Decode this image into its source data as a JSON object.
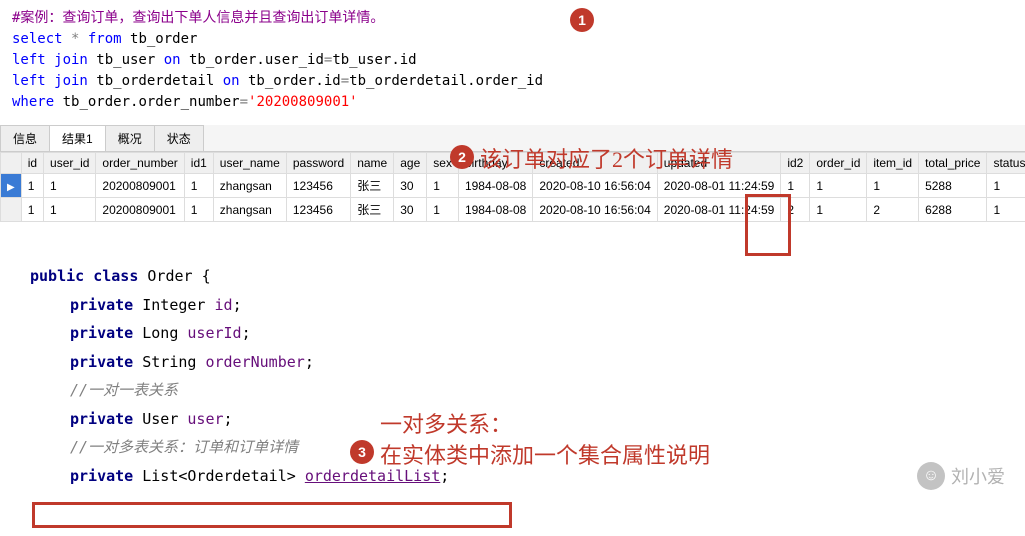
{
  "sql": {
    "comment": "#案例：查询订单，查询出下单人信息并且查询出订单详情。",
    "l1_select": "select",
    "l1_star": " * ",
    "l1_from": "from",
    "l1_tbl": " tb_order",
    "l2_a": "  left join",
    "l2_b": " tb_user ",
    "l2_c": "on",
    "l2_d": " tb_order.user_id",
    "l2_e": "=",
    "l2_f": "tb_user.id",
    "l3_a": "  left join",
    "l3_b": " tb_orderdetail ",
    "l3_c": "on",
    "l3_d": " tb_order.id",
    "l3_e": "=",
    "l3_f": "tb_orderdetail.order_id",
    "l4_a": "where",
    "l4_b": " tb_order.order_number",
    "l4_c": "=",
    "l4_d": "'20200809001'"
  },
  "badges": {
    "b1": "1",
    "b2": "2",
    "b3": "3"
  },
  "annot": {
    "a2": "该订单对应了2个订单详情",
    "a3l1": "一对多关系：",
    "a3l2": "在实体类中添加一个集合属性说明"
  },
  "tabs": {
    "t0": "信息",
    "t1": "结果1",
    "t2": "概况",
    "t3": "状态"
  },
  "cols": [
    "id",
    "user_id",
    "order_number",
    "id1",
    "user_name",
    "password",
    "name",
    "age",
    "sex",
    "birthday",
    "created",
    "updated",
    "id2",
    "order_id",
    "item_id",
    "total_price",
    "status"
  ],
  "rows": [
    [
      "1",
      "1",
      "20200809001",
      "1",
      "zhangsan",
      "123456",
      "张三",
      "30",
      "1",
      "1984-08-08",
      "2020-08-10 16:56:04",
      "2020-08-01 11:24:59",
      "1",
      "1",
      "1",
      "5288",
      "1"
    ],
    [
      "1",
      "1",
      "20200809001",
      "1",
      "zhangsan",
      "123456",
      "张三",
      "30",
      "1",
      "1984-08-08",
      "2020-08-10 16:56:04",
      "2020-08-01 11:24:59",
      "2",
      "1",
      "2",
      "6288",
      "1"
    ]
  ],
  "java": {
    "l1a": "public class",
    "l1b": " Order {",
    "l2a": "private",
    "l2b": " Integer ",
    "l2c": "id",
    "l2d": ";",
    "l3a": "private",
    "l3b": " Long ",
    "l3c": "userId",
    "l3d": ";",
    "l4a": "private",
    "l4b": " String ",
    "l4c": "orderNumber",
    "l4d": ";",
    "c1": "//一对一表关系",
    "l5a": "private",
    "l5b": " User ",
    "l5c": "user",
    "l5d": ";",
    "c2": "//一对多表关系：订单和订单详情",
    "l6a": "private",
    "l6b": " List<Orderdetail> ",
    "l6c": "orderdetailList",
    "l6d": ";"
  },
  "watermark": {
    "icon": "☺",
    "text": "刘小爱"
  }
}
